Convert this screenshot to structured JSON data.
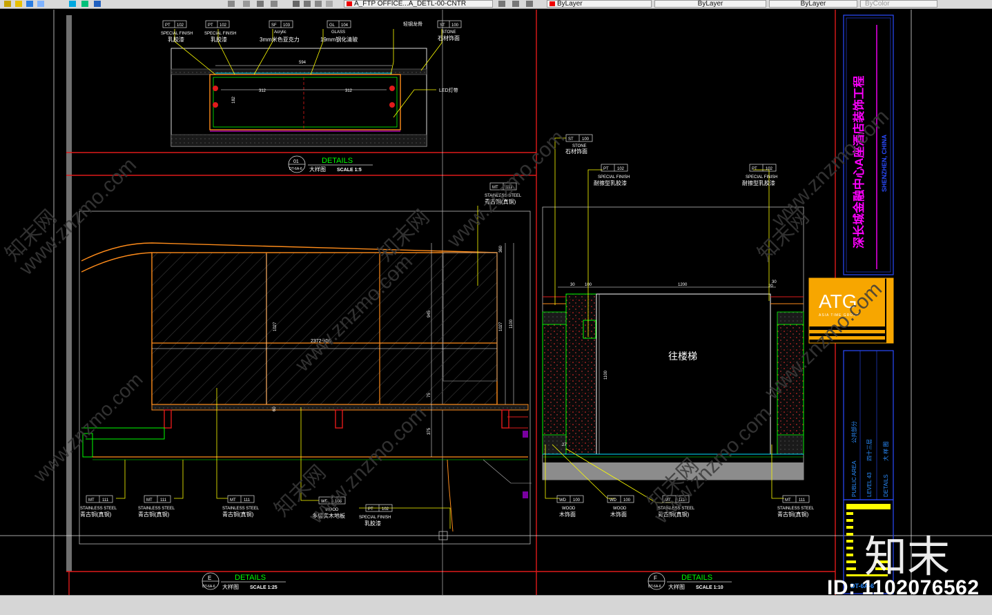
{
  "toolbar": {
    "layer_name": "A_FTP OFFICE...A_DETL-00-CNTR",
    "color_control": "ByLayer",
    "linetype_control": "ByLayer",
    "lineweight_control": "ByLayer",
    "plotstyle_control": "ByColor"
  },
  "colors": {
    "background": "#000000",
    "frame_red": "#e01b1b",
    "outline_orange": "#ff8c1a",
    "leader_yellow": "#ffff00",
    "green": "#00ff00",
    "cyan": "#00e5ff",
    "magenta": "#ff00ff",
    "atg_orange": "#f7a600"
  },
  "detail_01": {
    "tags": [
      {
        "code": "PT",
        "num": "102",
        "en": "SPECIAL FINISH",
        "cn": "乳胶漆"
      },
      {
        "code": "PT",
        "num": "102",
        "en": "SPECIAL FINISH",
        "cn": "乳胶漆"
      },
      {
        "code": "SF",
        "num": "103",
        "en": "Acrylic",
        "cn": "3mm米色亚克力"
      },
      {
        "code": "GL",
        "num": "104",
        "en": "GLASS",
        "cn": "19mm钢化清玻"
      },
      {
        "code": "",
        "num": "",
        "en": "",
        "cn": "轻钢龙骨"
      },
      {
        "code": "ST",
        "num": "100",
        "en": "STONE",
        "cn": "石材饰面"
      }
    ],
    "led_label": "LED灯带",
    "dim_top": "594",
    "dim_left": "312",
    "dim_right": "312",
    "dim_height": "182",
    "title_num": "01",
    "title_ref": "DT-6A-6",
    "title": "DETAILS",
    "title_cn": "大样图",
    "scale": "SCALE 1:5"
  },
  "detail_e": {
    "tag_top": {
      "code": "MT",
      "num": "111",
      "en": "STAINLESS STEEL",
      "cn": "青古铜(真铜)"
    },
    "tags_bottom": [
      {
        "code": "MT",
        "num": "111",
        "en": "STAINLESS STEEL",
        "cn": "青古铜(真铜)"
      },
      {
        "code": "MT",
        "num": "111",
        "en": "STAINLESS STEEL",
        "cn": "青古铜(真铜)"
      },
      {
        "code": "MT",
        "num": "111",
        "en": "STAINLESS STEEL",
        "cn": "青古铜(真铜)"
      },
      {
        "code": "WF",
        "num": "106",
        "en": "WOOD",
        "cn": "多层实木地板"
      },
      {
        "code": "PT",
        "num": "102",
        "en": "SPECIAL FINISH",
        "cn": "乳胶漆"
      }
    ],
    "dim_width": "2372-350",
    "dim_1027a": "1027",
    "dim_1027b": "1027",
    "dim_1100": "1100",
    "dim_945": "945",
    "dim_75": "75",
    "dim_375": "375",
    "dim_60": "60",
    "dim_360": "360",
    "title_num": "E",
    "title_ref": "DT-6A-6",
    "title": "DETAILS",
    "title_cn": "大样图",
    "scale": "SCALE 1:25"
  },
  "detail_f": {
    "tags_top": [
      {
        "code": "ST",
        "num": "100",
        "en": "STONE",
        "cn": "石材饰面"
      },
      {
        "code": "PT",
        "num": "102",
        "en": "SPECIAL FINISH",
        "cn": "耐擦型乳胶漆"
      },
      {
        "code": "PT",
        "num": "102",
        "en": "SPECIAL FINISH",
        "cn": "耐擦型乳胶漆"
      }
    ],
    "tags_bottom": [
      {
        "code": "WD",
        "num": "100",
        "en": "WOOD",
        "cn": "木饰面"
      },
      {
        "code": "WD",
        "num": "100",
        "en": "WOOD",
        "cn": "木饰面"
      },
      {
        "code": "MT",
        "num": "111",
        "en": "STAINLESS STEEL",
        "cn": "青古铜(真铜)"
      },
      {
        "code": "MT",
        "num": "111",
        "en": "STAINLESS STEEL",
        "cn": "青古铜(真铜)"
      }
    ],
    "room_label": "往楼梯",
    "dim_1200": "1200",
    "dim_100": "100",
    "dim_30a": "30",
    "dim_30b": "30",
    "dim_20": "20",
    "dim_1100": "1100",
    "dim_27": "27",
    "title_num": "F",
    "title_ref": "DT-6A-6",
    "title": "DETAILS",
    "title_cn": "大样图",
    "scale": "SCALE 1:10"
  },
  "title_block": {
    "project_cn": "深长城金融中心A座酒店装饰工程",
    "city_en": "SHENZHEN, CHINA",
    "logo": "ATG",
    "logo_sub": "ASIA TIME GROUP",
    "area_en": "PUBLIC AREA",
    "area_cn": "公共部分",
    "level_en": "LEVEL 43",
    "level_cn": "四十三层",
    "sheet_en": "DETAILS",
    "sheet_cn": "大 样 图",
    "sheet_no": "DT-6A-6"
  },
  "watermark": {
    "site": "www.znzmo.com",
    "cn": "知末网",
    "brand": "知末",
    "id_text": "ID: 1102076562"
  }
}
